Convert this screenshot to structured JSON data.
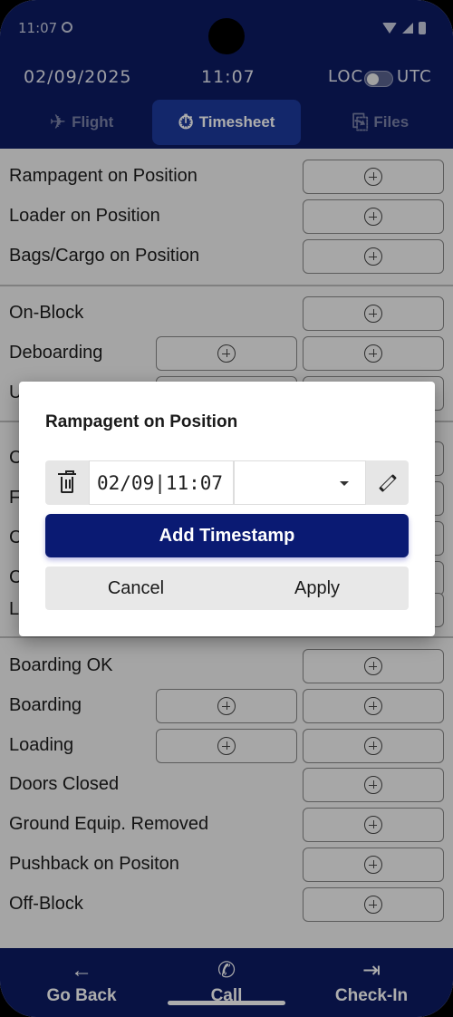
{
  "status_bar": {
    "time": "11:07"
  },
  "header": {
    "date": "02/09/2025",
    "time": "11:07",
    "tz_left": "LOC",
    "tz_right": "UTC",
    "tabs": [
      {
        "label": "Flight",
        "icon": "plane-icon",
        "active": false
      },
      {
        "label": "Timesheet",
        "icon": "stopwatch-icon",
        "active": true
      },
      {
        "label": "Files",
        "icon": "paperclip-icon",
        "active": false
      }
    ]
  },
  "list": {
    "rows": [
      {
        "label": "Rampagent on Position"
      },
      {
        "label": "Loader on Position"
      },
      {
        "label": "Bags/Cargo on Position"
      },
      {
        "label": "On-Block"
      },
      {
        "label": "Deboarding"
      },
      {
        "label": "U"
      },
      {
        "label": "C"
      },
      {
        "label": "F"
      },
      {
        "label": "C"
      },
      {
        "label": "C"
      },
      {
        "label": "L"
      },
      {
        "label": "Boarding OK"
      },
      {
        "label": "Boarding"
      },
      {
        "label": "Loading"
      },
      {
        "label": "Doors Closed"
      },
      {
        "label": "Ground Equip. Removed"
      },
      {
        "label": "Pushback on Positon"
      },
      {
        "label": "Off-Block"
      }
    ]
  },
  "dialog": {
    "title": "Rampagent on Position",
    "datetime_value": "02/09|11:07",
    "select_value": "",
    "add_label": "Add Timestamp",
    "cancel_label": "Cancel",
    "apply_label": "Apply"
  },
  "bottom_bar": {
    "items": [
      {
        "label": "Go Back",
        "icon": "arrow-left-icon"
      },
      {
        "label": "Call",
        "icon": "phone-icon"
      },
      {
        "label": "Check-In",
        "icon": "login-icon"
      }
    ]
  },
  "colors": {
    "header_bg": "#0d1b63",
    "active_tab": "#1c3a9e",
    "primary_button": "#0a1a73"
  }
}
